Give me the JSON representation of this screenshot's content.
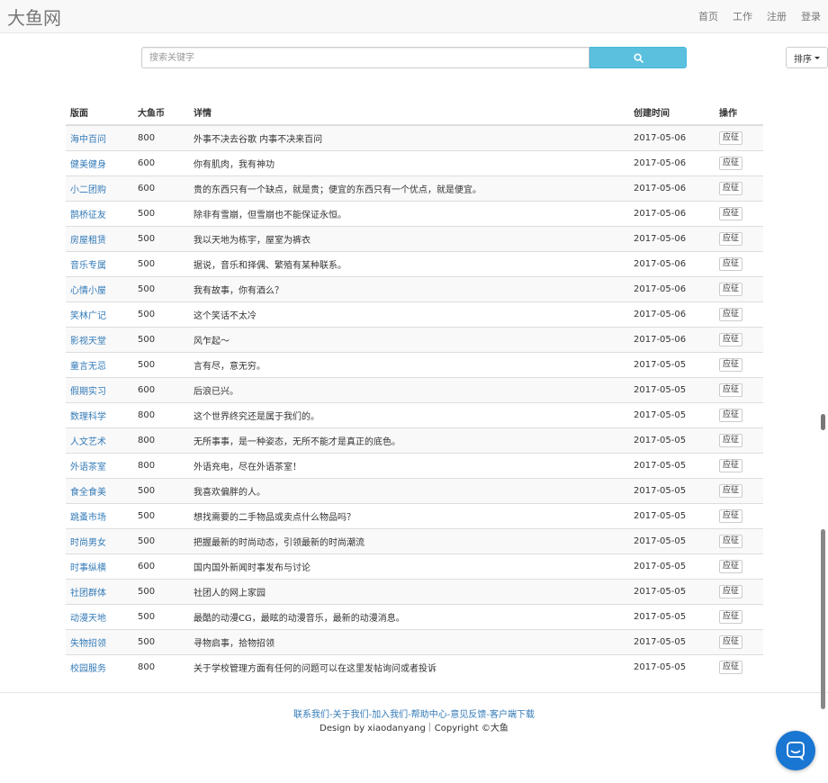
{
  "brand": "大鱼网",
  "nav": [
    "首页",
    "工作",
    "注册",
    "登录"
  ],
  "search": {
    "placeholder": "搜索关键字"
  },
  "sort_label": "排序",
  "table": {
    "headers": [
      "版面",
      "大鱼币",
      "详情",
      "创建时间",
      "操作"
    ],
    "rows": [
      {
        "board": "海中百问",
        "coins": "800",
        "detail": "外事不决去谷歌 内事不决来百问",
        "date": "2017-05-06",
        "action": "应征"
      },
      {
        "board": "健美健身",
        "coins": "600",
        "detail": "你有肌肉，我有神功",
        "date": "2017-05-06",
        "action": "应征"
      },
      {
        "board": "小二团购",
        "coins": "600",
        "detail": "贵的东西只有一个缺点，就是贵；便宜的东西只有一个优点，就是便宜。",
        "date": "2017-05-06",
        "action": "应征"
      },
      {
        "board": "鹊桥征友",
        "coins": "500",
        "detail": "除非有雪崩，但雪崩也不能保证永恒。",
        "date": "2017-05-06",
        "action": "应征"
      },
      {
        "board": "房屋租赁",
        "coins": "500",
        "detail": "我以天地为栋宇，屋室为裤衣",
        "date": "2017-05-06",
        "action": "应征"
      },
      {
        "board": "音乐专属",
        "coins": "500",
        "detail": "据说，音乐和择偶、繁殖有某种联系。",
        "date": "2017-05-06",
        "action": "应征"
      },
      {
        "board": "心情小屋",
        "coins": "500",
        "detail": "我有故事，你有酒么？",
        "date": "2017-05-06",
        "action": "应征"
      },
      {
        "board": "笑林广记",
        "coins": "500",
        "detail": "这个笑话不太冷",
        "date": "2017-05-06",
        "action": "应征"
      },
      {
        "board": "影视天堂",
        "coins": "500",
        "detail": "风乍起～",
        "date": "2017-05-06",
        "action": "应征"
      },
      {
        "board": "童言无忌",
        "coins": "500",
        "detail": "言有尽，意无穷。",
        "date": "2017-05-05",
        "action": "应征"
      },
      {
        "board": "假期实习",
        "coins": "600",
        "detail": "后浪已兴。",
        "date": "2017-05-05",
        "action": "应征"
      },
      {
        "board": "数理科学",
        "coins": "800",
        "detail": "这个世界终究还是属于我们的。",
        "date": "2017-05-05",
        "action": "应征"
      },
      {
        "board": "人文艺术",
        "coins": "800",
        "detail": "无所事事，是一种姿态，无所不能才是真正的底色。",
        "date": "2017-05-05",
        "action": "应征"
      },
      {
        "board": "外语茶室",
        "coins": "800",
        "detail": "外语充电，尽在外语茶室！",
        "date": "2017-05-05",
        "action": "应征"
      },
      {
        "board": "食全食美",
        "coins": "500",
        "detail": "我喜欢偏胖的人。",
        "date": "2017-05-05",
        "action": "应征"
      },
      {
        "board": "跳蚤市场",
        "coins": "500",
        "detail": "想找需要的二手物品或卖点什么物品吗？",
        "date": "2017-05-05",
        "action": "应征"
      },
      {
        "board": "时尚男女",
        "coins": "500",
        "detail": "把握最新的时尚动态，引领最新的时尚潮流",
        "date": "2017-05-05",
        "action": "应征"
      },
      {
        "board": "时事纵横",
        "coins": "600",
        "detail": "国内国外新闻时事发布与讨论",
        "date": "2017-05-05",
        "action": "应征"
      },
      {
        "board": "社团群体",
        "coins": "500",
        "detail": "社团人的网上家园",
        "date": "2017-05-05",
        "action": "应征"
      },
      {
        "board": "动漫天地",
        "coins": "500",
        "detail": "最酷的动漫CG，最眩的动漫音乐，最新的动漫消息。",
        "date": "2017-05-05",
        "action": "应征"
      },
      {
        "board": "失物招领",
        "coins": "500",
        "detail": "寻物启事，拾物招领",
        "date": "2017-05-05",
        "action": "应征"
      },
      {
        "board": "校园服务",
        "coins": "800",
        "detail": "关于学校管理方面有任何的问题可以在这里发帖询问或者投诉",
        "date": "2017-05-05",
        "action": "应征"
      }
    ]
  },
  "footer": {
    "links": [
      "联系我们",
      "关于我们",
      "加入我们",
      "帮助中心",
      "意见反馈",
      "客户端下载"
    ],
    "separator": "-",
    "credit": "Design by xiaodanyang｜Copyright ©大鱼"
  },
  "icons": {
    "search": "search-icon",
    "sort_caret": "caret-down-icon",
    "chat": "chat-icon"
  },
  "colors": {
    "link": "#337ab7",
    "search_button": "#5bc0de",
    "chat_button": "#1976d2",
    "navbar": "#f8f8f8"
  }
}
